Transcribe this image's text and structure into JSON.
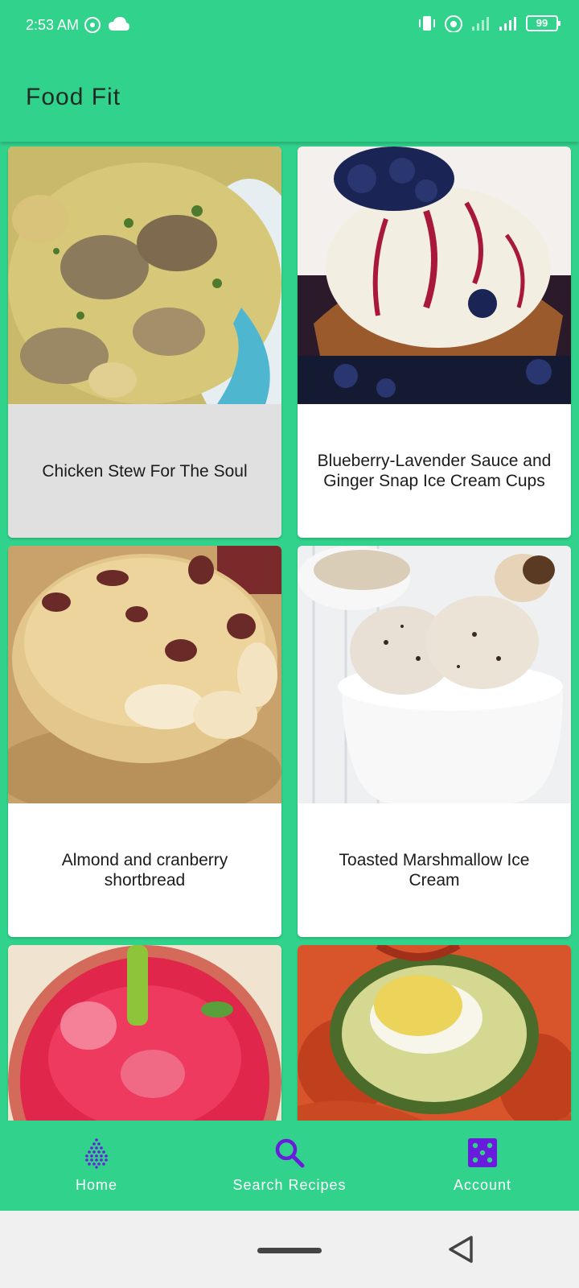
{
  "status": {
    "time": "2:53 AM",
    "battery": "99"
  },
  "app": {
    "title": "Food Fit"
  },
  "recipes": [
    {
      "title": "Chicken Stew For The Soul",
      "image": "chicken-stew-image"
    },
    {
      "title": "Blueberry-Lavender Sauce and Ginger Snap Ice Cream Cups",
      "image": "ice-cream-cup-image"
    },
    {
      "title": "Almond and cranberry shortbread",
      "image": "shortbread-image"
    },
    {
      "title": "Toasted Marshmallow Ice Cream",
      "image": "marshmallow-ice-cream-image"
    },
    {
      "title": "",
      "image": "pink-drink-image"
    },
    {
      "title": "",
      "image": "deviled-egg-avocado-image"
    }
  ],
  "bottom_nav": {
    "home": "Home",
    "search": "Search Recipes",
    "account": "Account"
  },
  "colors": {
    "primary": "#31d38c",
    "accent_purple": "#6a1bdc"
  }
}
